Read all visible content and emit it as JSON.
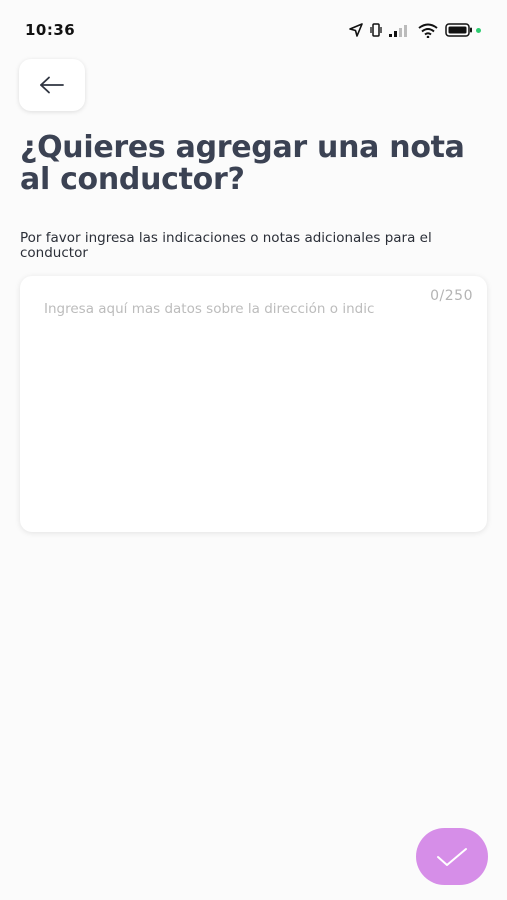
{
  "status_bar": {
    "time": "10:36",
    "icons": [
      "location-arrow-icon",
      "vibrate-icon",
      "signal-icon",
      "wifi-icon",
      "battery-icon"
    ]
  },
  "header": {
    "back_icon": "arrow-left-icon"
  },
  "main": {
    "title": "¿Quieres agregar una nota al conductor?",
    "subtitle": "Por favor ingresa las indicaciones o notas adicionales para el conductor",
    "note": {
      "value": "",
      "placeholder": "Ingresa aquí mas datos sobre la dirección o indic",
      "counter": "0/250"
    }
  },
  "actions": {
    "confirm_icon": "check-icon"
  },
  "colors": {
    "background": "#fbfbfb",
    "title": "#3b4253",
    "accent": "#d68ee8",
    "placeholder": "#bcbcbc"
  }
}
